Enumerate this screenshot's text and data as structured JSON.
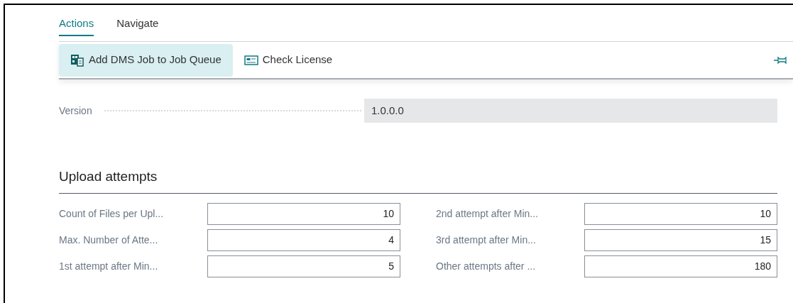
{
  "tabs": [
    {
      "label": "Actions",
      "selected": true
    },
    {
      "label": "Navigate",
      "selected": false
    }
  ],
  "actions": [
    {
      "label": "Add DMS Job to Job Queue",
      "kind": "queue",
      "selected": true
    },
    {
      "label": "Check License",
      "kind": "license",
      "selected": false
    }
  ],
  "version": {
    "label": "Version",
    "value": "1.0.0.0"
  },
  "section": {
    "title": "Upload attempts",
    "fields": [
      {
        "label": "Count of Files per Upl...",
        "value": "10"
      },
      {
        "label": "2nd attempt after Min...",
        "value": "10"
      },
      {
        "label": "Max. Number of Atte...",
        "value": "4"
      },
      {
        "label": "3rd attempt after Min...",
        "value": "15"
      },
      {
        "label": "1st attempt after Min...",
        "value": "5"
      },
      {
        "label": "Other attempts after ...",
        "value": "180"
      }
    ]
  }
}
